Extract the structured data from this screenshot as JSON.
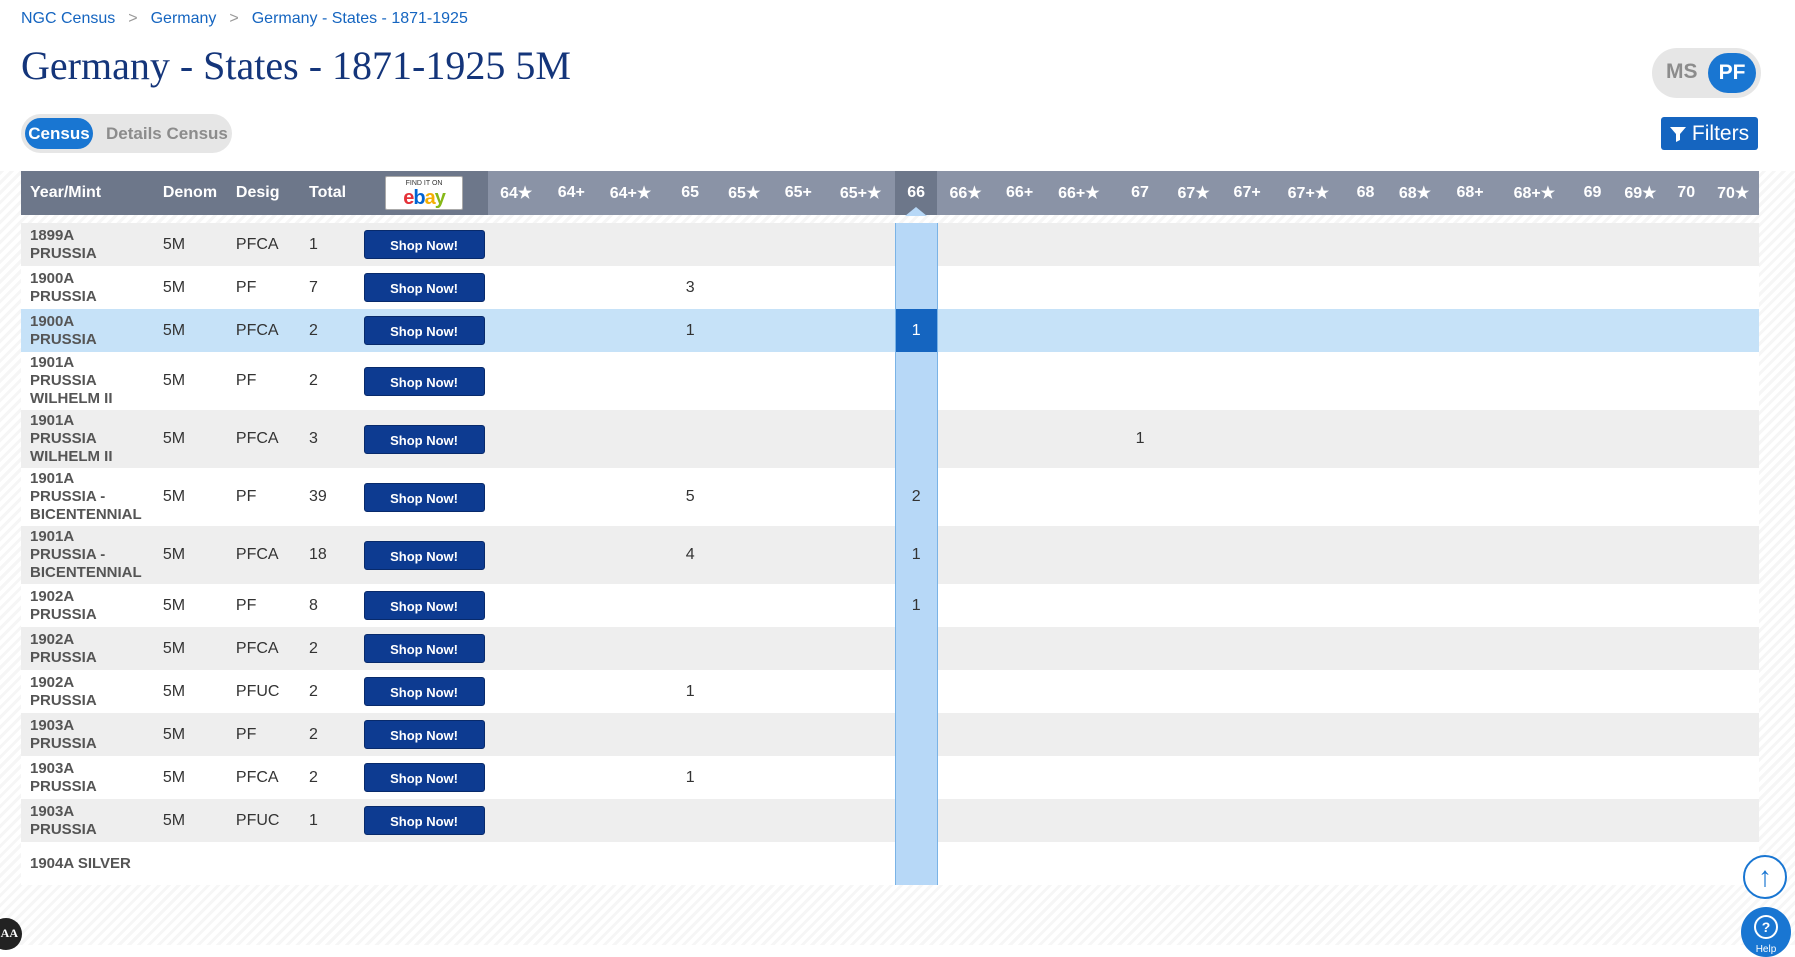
{
  "breadcrumb": {
    "items": [
      "NGC Census",
      "Germany",
      "Germany - States - 1871-1925"
    ],
    "separator": ">"
  },
  "title": "Germany - States - 1871-1925 5M",
  "strike_toggle": {
    "ms": "MS",
    "pf": "PF",
    "active": "PF"
  },
  "view_toggle": {
    "census": "Census",
    "details": "Details Census",
    "active": "Census"
  },
  "filters_label": "Filters",
  "table": {
    "headers": {
      "year_mint": "Year/Mint",
      "denom": "Denom",
      "desig": "Desig",
      "total": "Total"
    },
    "ebay": {
      "find": "FIND IT ON",
      "logo": [
        "e",
        "b",
        "a",
        "y"
      ]
    },
    "grades": [
      "64★",
      "64+",
      "64+★",
      "65",
      "65★",
      "65+",
      "65+★",
      "66",
      "66★",
      "66+",
      "66+★",
      "67",
      "67★",
      "67+",
      "67+★",
      "68",
      "68★",
      "68+",
      "68+★",
      "69",
      "69★",
      "70",
      "70★"
    ],
    "selected_grade": "66",
    "shop_label": "Shop Now!",
    "rows": [
      {
        "mint": [
          "1899A",
          "PRUSSIA"
        ],
        "denom": "5M",
        "desig": "PFCA",
        "total": "1",
        "counts": {}
      },
      {
        "mint": [
          "1900A",
          "PRUSSIA"
        ],
        "denom": "5M",
        "desig": "PF",
        "total": "7",
        "counts": {
          "65": "3"
        }
      },
      {
        "mint": [
          "1900A",
          "PRUSSIA"
        ],
        "denom": "5M",
        "desig": "PFCA",
        "total": "2",
        "counts": {
          "65": "1",
          "66": "1"
        },
        "highlight": true
      },
      {
        "mint": [
          "1901A",
          "PRUSSIA",
          "WILHELM II"
        ],
        "denom": "5M",
        "desig": "PF",
        "total": "2",
        "counts": {}
      },
      {
        "mint": [
          "1901A",
          "PRUSSIA",
          "WILHELM II"
        ],
        "denom": "5M",
        "desig": "PFCA",
        "total": "3",
        "counts": {
          "67": "1"
        }
      },
      {
        "mint": [
          "1901A",
          "PRUSSIA -",
          "BICENTENNIAL"
        ],
        "denom": "5M",
        "desig": "PF",
        "total": "39",
        "counts": {
          "65": "5",
          "66": "2"
        }
      },
      {
        "mint": [
          "1901A",
          "PRUSSIA -",
          "BICENTENNIAL"
        ],
        "denom": "5M",
        "desig": "PFCA",
        "total": "18",
        "counts": {
          "65": "4",
          "66": "1"
        }
      },
      {
        "mint": [
          "1902A",
          "PRUSSIA"
        ],
        "denom": "5M",
        "desig": "PF",
        "total": "8",
        "counts": {
          "66": "1"
        }
      },
      {
        "mint": [
          "1902A",
          "PRUSSIA"
        ],
        "denom": "5M",
        "desig": "PFCA",
        "total": "2",
        "counts": {}
      },
      {
        "mint": [
          "1902A",
          "PRUSSIA"
        ],
        "denom": "5M",
        "desig": "PFUC",
        "total": "2",
        "counts": {
          "65": "1"
        }
      },
      {
        "mint": [
          "1903A",
          "PRUSSIA"
        ],
        "denom": "5M",
        "desig": "PF",
        "total": "2",
        "counts": {}
      },
      {
        "mint": [
          "1903A",
          "PRUSSIA"
        ],
        "denom": "5M",
        "desig": "PFCA",
        "total": "2",
        "counts": {
          "65": "1"
        }
      },
      {
        "mint": [
          "1903A",
          "PRUSSIA"
        ],
        "denom": "5M",
        "desig": "PFUC",
        "total": "1",
        "counts": {}
      },
      {
        "mint": [
          "1904A SILVER"
        ],
        "denom": "",
        "desig": "",
        "total": "",
        "counts": {}
      }
    ]
  },
  "floating": {
    "help_label": "Help",
    "aa_label": "AA",
    "top_arrow": "↑",
    "help_glyph": "?"
  },
  "colors": {
    "accent": "#1976d2",
    "navy_button": "#0d3b91",
    "header_bg": "#6d778a",
    "title": "#14357a"
  }
}
